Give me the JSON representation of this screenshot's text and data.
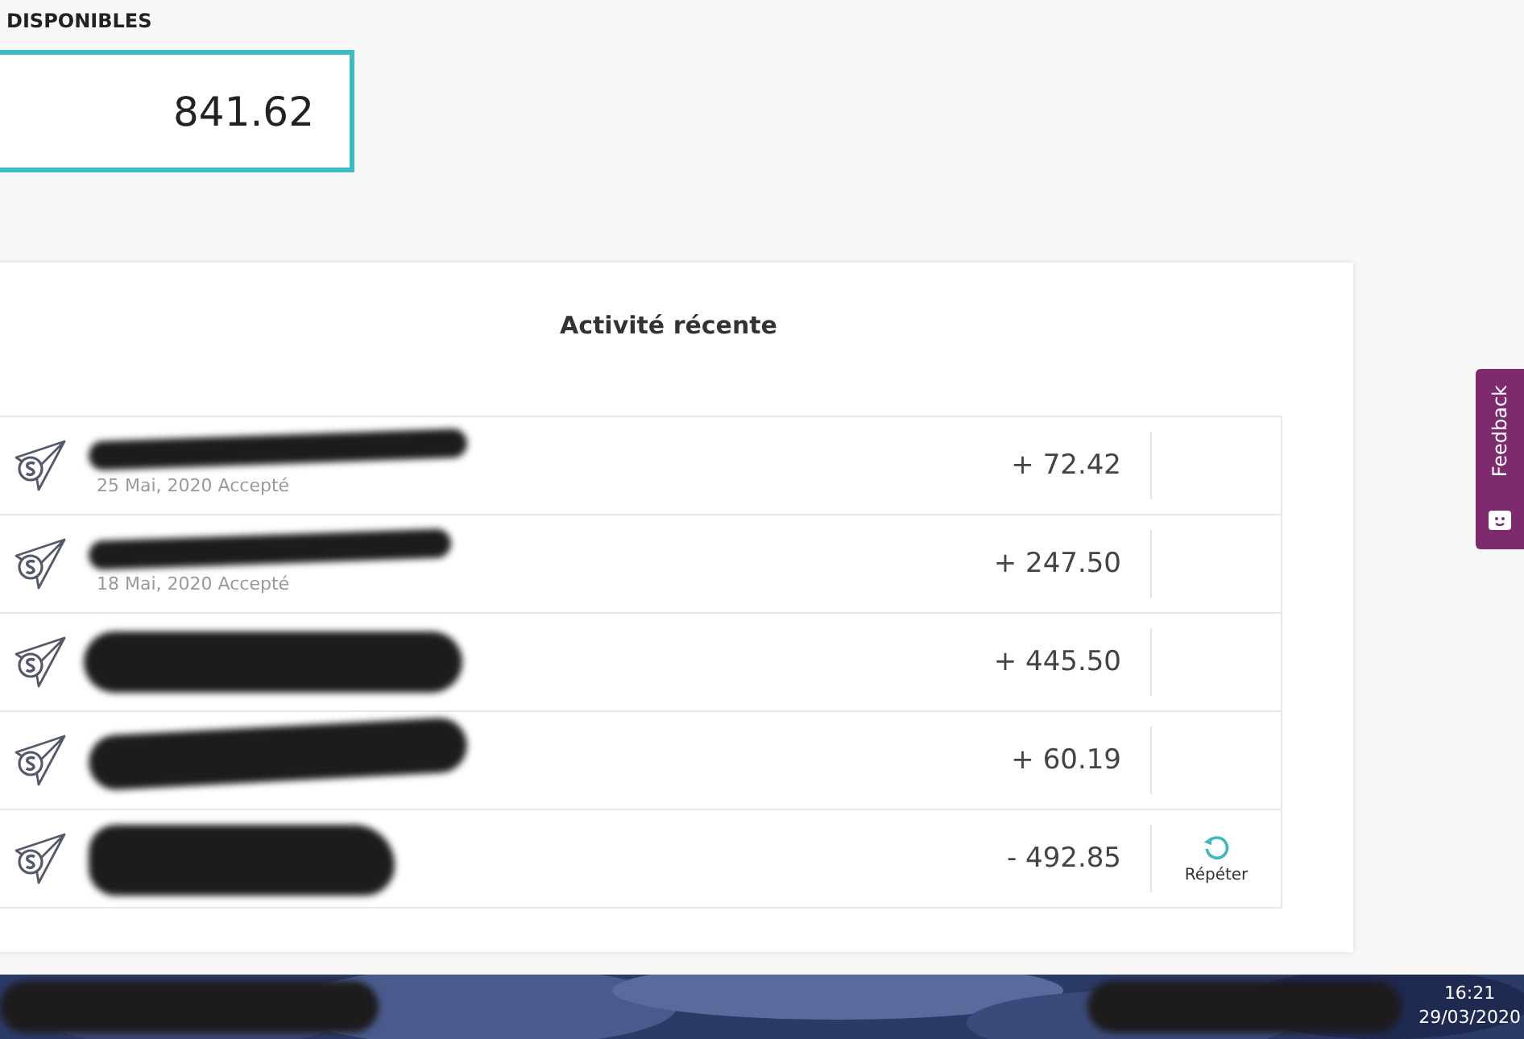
{
  "balance": {
    "label": "DISPONIBLES",
    "amount": "841.62"
  },
  "activity": {
    "title": "Activité récente",
    "rows": [
      {
        "date": "25 Mai, 2020  Accepté",
        "amount": "+ 72.42",
        "action": null
      },
      {
        "date": "18 Mai, 2020  Accepté",
        "amount": "+ 247.50",
        "action": null
      },
      {
        "amount": "+ 445.50",
        "action": null
      },
      {
        "amount": "+ 60.19",
        "action": null
      },
      {
        "amount": "- 492.85",
        "action": "Répéter"
      }
    ]
  },
  "feedback_tab": {
    "label": "Feedback"
  },
  "taskbar": {
    "time": "16:21",
    "date": "29/03/2020"
  }
}
